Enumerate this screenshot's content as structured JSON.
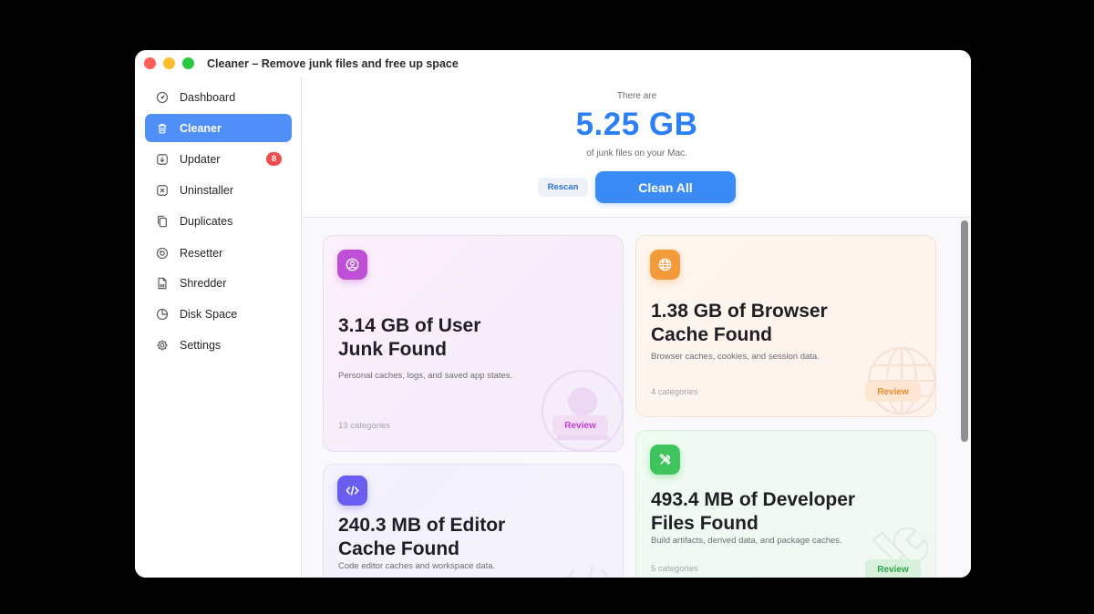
{
  "window": {
    "title": "Cleaner – Remove junk files and free up space"
  },
  "sidebar": {
    "items": [
      {
        "label": "Dashboard",
        "icon": "gauge-icon"
      },
      {
        "label": "Cleaner",
        "icon": "trash-icon",
        "active": true
      },
      {
        "label": "Updater",
        "icon": "download-icon",
        "badge": "8"
      },
      {
        "label": "Uninstaller",
        "icon": "x-square-icon"
      },
      {
        "label": "Duplicates",
        "icon": "copy-icon"
      },
      {
        "label": "Resetter",
        "icon": "reset-icon"
      },
      {
        "label": "Shredder",
        "icon": "shredder-icon"
      },
      {
        "label": "Disk Space",
        "icon": "pie-chart-icon"
      },
      {
        "label": "Settings",
        "icon": "gear-icon"
      }
    ]
  },
  "hero": {
    "pre_text": "There are",
    "total_size": "5.25 GB",
    "post_text": "of junk files on your Mac.",
    "rescan_label": "Rescan",
    "clean_all_label": "Clean All"
  },
  "cards": {
    "user": {
      "title_line1": "3.14 GB of User",
      "title_line2": "Junk Found",
      "description": "Personal caches, logs, and saved app states.",
      "count": "13 categories",
      "review_label": "Review",
      "icon": "user-circle-icon"
    },
    "browser": {
      "title_line1": "1.38 GB of Browser",
      "title_line2": "Cache Found",
      "description": "Browser caches, cookies, and session data.",
      "count": "4 categories",
      "review_label": "Review",
      "icon": "globe-icon"
    },
    "editor": {
      "title_line1": "240.3 MB of Editor",
      "title_line2": "Cache Found",
      "description": "Code editor caches and workspace data.",
      "icon": "code-icon"
    },
    "developer": {
      "title_line1": "493.4 MB of Developer",
      "title_line2": "Files Found",
      "description": "Build artifacts, derived data, and package caches.",
      "count": "5 categories",
      "review_label": "Review",
      "icon": "tools-icon"
    }
  },
  "colors": {
    "accent": "#3a8bf6",
    "user": "#c04fd8",
    "browser": "#f39a3b",
    "editor": "#6a5ef0",
    "developer": "#3fc35c",
    "badge": "#ef4d4d"
  }
}
